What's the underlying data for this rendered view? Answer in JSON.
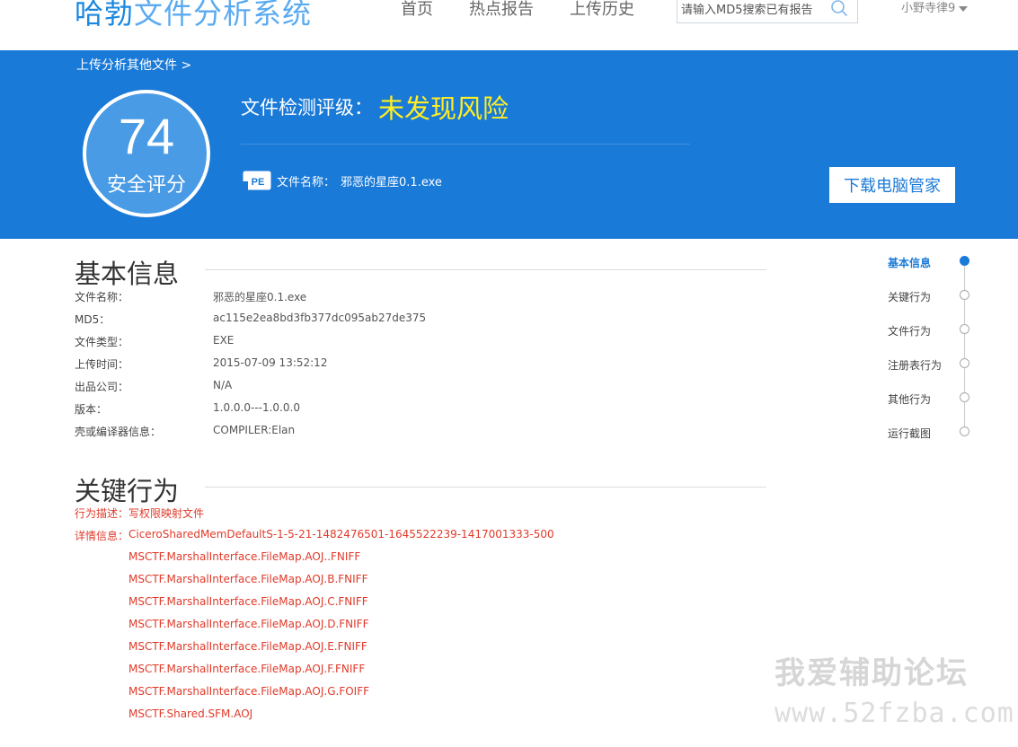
{
  "header": {
    "logo_main": "哈勃",
    "logo_sub": "文件分析系统",
    "nav": [
      "首页",
      "热点报告",
      "上传历史"
    ],
    "search_placeholder": "请输入MD5搜索已有报告",
    "user": "小野寺律9"
  },
  "banner": {
    "breadcrumb": "上传分析其他文件 >",
    "score": "74",
    "score_label": "安全评分",
    "rating_label": "文件检测评级：",
    "rating_value": "未发现风险",
    "pe_badge": "PE",
    "file_label": "文件名称：",
    "file_name": "邪恶的星座0.1.exe",
    "download_button": "下载电脑管家"
  },
  "basic_info": {
    "title": "基本信息",
    "rows": [
      {
        "k": "文件名称：",
        "v": "邪恶的星座0.1.exe"
      },
      {
        "k": "MD5：",
        "v": "ac115e2ea8bd3fb377dc095ab27de375"
      },
      {
        "k": "文件类型：",
        "v": "EXE"
      },
      {
        "k": "上传时间：",
        "v": "2015-07-09 13:52:12"
      },
      {
        "k": "出品公司：",
        "v": "N/A"
      },
      {
        "k": "版本：",
        "v": "1.0.0.0---1.0.0.0"
      },
      {
        "k": "壳或编译器信息：",
        "v": "COMPILER:Elan"
      }
    ]
  },
  "key_behavior": {
    "title": "关键行为",
    "desc_label": "行为描述：",
    "desc_value": "写权限映射文件",
    "detail_label": "详情信息：",
    "details": [
      "CiceroSharedMemDefaultS-1-5-21-1482476501-1645522239-1417001333-500",
      "MSCTF.MarshalInterface.FileMap.AOJ..FNIFF",
      "MSCTF.MarshalInterface.FileMap.AOJ.B.FNIFF",
      "MSCTF.MarshalInterface.FileMap.AOJ.C.FNIFF",
      "MSCTF.MarshalInterface.FileMap.AOJ.D.FNIFF",
      "MSCTF.MarshalInterface.FileMap.AOJ.E.FNIFF",
      "MSCTF.MarshalInterface.FileMap.AOJ.F.FNIFF",
      "MSCTF.MarshalInterface.FileMap.AOJ.G.FOIFF",
      "MSCTF.Shared.SFM.AOJ"
    ]
  },
  "sidenav": {
    "items": [
      "基本信息",
      "关键行为",
      "文件行为",
      "注册表行为",
      "其他行为",
      "运行截图"
    ],
    "active": "基本信息"
  },
  "watermark": {
    "line1": "我爱辅助论坛",
    "line2": "www.52fzba.com"
  },
  "colors": {
    "brand_blue": "#1a7ad8",
    "rating_yellow": "#ffee22",
    "behavior_red": "#e03a2a"
  }
}
